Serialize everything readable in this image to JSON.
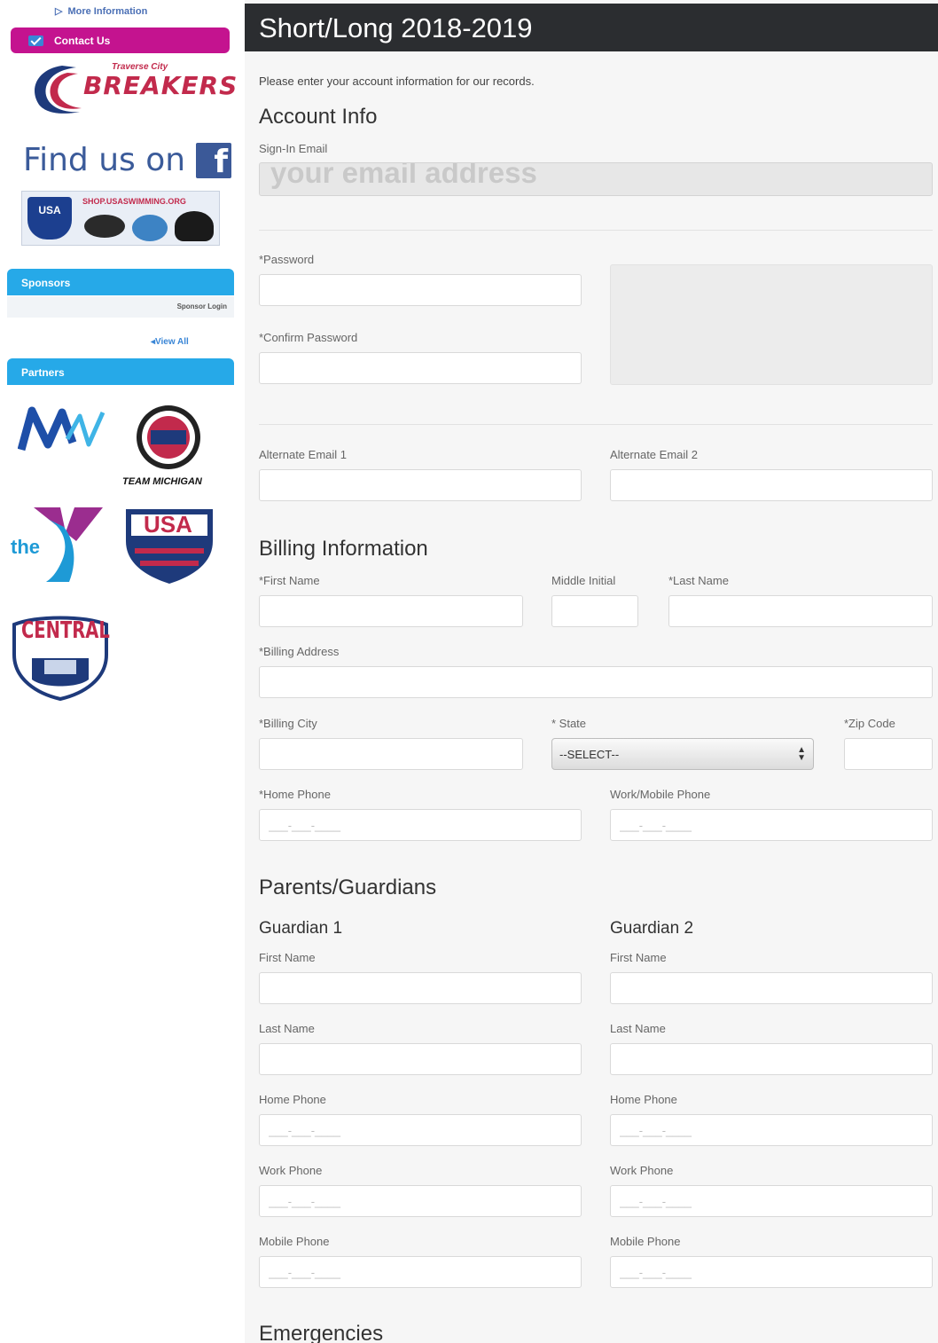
{
  "sidebar": {
    "more_info": "More Information",
    "contact_us": "Contact Us",
    "logo": {
      "sub": "Traverse City",
      "main": "BREAKERS"
    },
    "find_us": "Find us on",
    "shop_banner": "SHOP.USASWIMMING.ORG",
    "sponsors_header": "Sponsors",
    "sponsor_login": "Sponsor Login",
    "view_all": "View All",
    "partners_header": "Partners",
    "partners": {
      "team_michigan": "TEAM MICHIGAN",
      "ymca": "the",
      "usa_swimming": "USA",
      "central_zone": "CENTRAL"
    }
  },
  "main": {
    "title": "Short/Long 2018-2019",
    "intro": "Please enter your account information for our records.",
    "account": {
      "title": "Account Info",
      "signin_email_label": "Sign-In Email",
      "signin_email_value": "your email address",
      "password_label": "*Password",
      "confirm_password_label": "*Confirm Password",
      "alt_email1_label": "Alternate Email 1",
      "alt_email2_label": "Alternate Email 2"
    },
    "billing": {
      "title": "Billing Information",
      "first_name_label": "*First Name",
      "middle_initial_label": "Middle Initial",
      "last_name_label": "*Last Name",
      "address_label": "*Billing Address",
      "city_label": "*Billing City",
      "state_label": "* State",
      "state_value": "--SELECT--",
      "zip_label": "*Zip Code",
      "home_phone_label": "*Home Phone",
      "work_mobile_label": "Work/Mobile Phone",
      "phone_placeholder": "___-___-____"
    },
    "guardians": {
      "title": "Parents/Guardians",
      "g1_title": "Guardian 1",
      "g2_title": "Guardian 2",
      "first_name_label": "First Name",
      "last_name_label": "Last Name",
      "home_phone_label": "Home Phone",
      "work_phone_label": "Work Phone",
      "mobile_phone_label": "Mobile Phone"
    },
    "emergencies": {
      "title": "Emergencies"
    }
  }
}
